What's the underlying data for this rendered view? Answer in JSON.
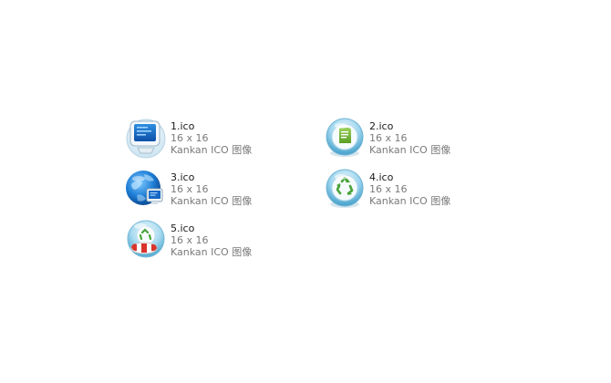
{
  "files": [
    {
      "name": "1.ico",
      "size": "16 x 16",
      "type": "Kankan ICO 图像",
      "icon": "monitor-icon"
    },
    {
      "name": "2.ico",
      "size": "16 x 16",
      "type": "Kankan ICO 图像",
      "icon": "document-bubble-icon"
    },
    {
      "name": "3.ico",
      "size": "16 x 16",
      "type": "Kankan ICO 图像",
      "icon": "globe-monitor-icon"
    },
    {
      "name": "4.ico",
      "size": "16 x 16",
      "type": "Kankan ICO 图像",
      "icon": "recycle-bubble-icon"
    },
    {
      "name": "5.ico",
      "size": "16 x 16",
      "type": "Kankan ICO 图像",
      "icon": "recycle-lifebuoy-icon"
    }
  ]
}
